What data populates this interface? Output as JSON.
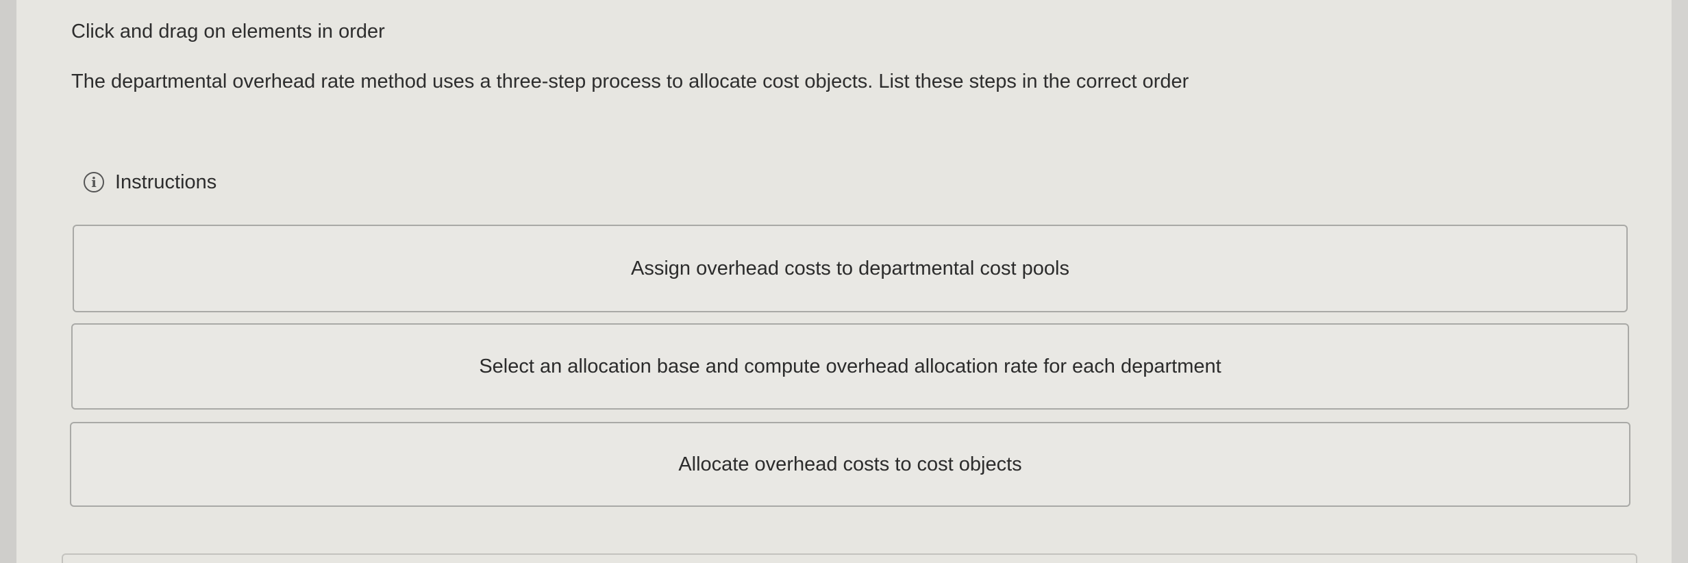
{
  "heading": "Click and drag on elements in order",
  "question": "The departmental overhead rate method uses a three-step process to allocate cost objects. List these steps in the correct order",
  "instructions": {
    "icon": "info-icon",
    "icon_glyph": "i",
    "label": "Instructions"
  },
  "steps": [
    {
      "label": "Assign overhead costs to departmental cost pools"
    },
    {
      "label": "Select an allocation base and compute overhead allocation rate for each department"
    },
    {
      "label": "Allocate overhead costs to cost objects"
    }
  ]
}
